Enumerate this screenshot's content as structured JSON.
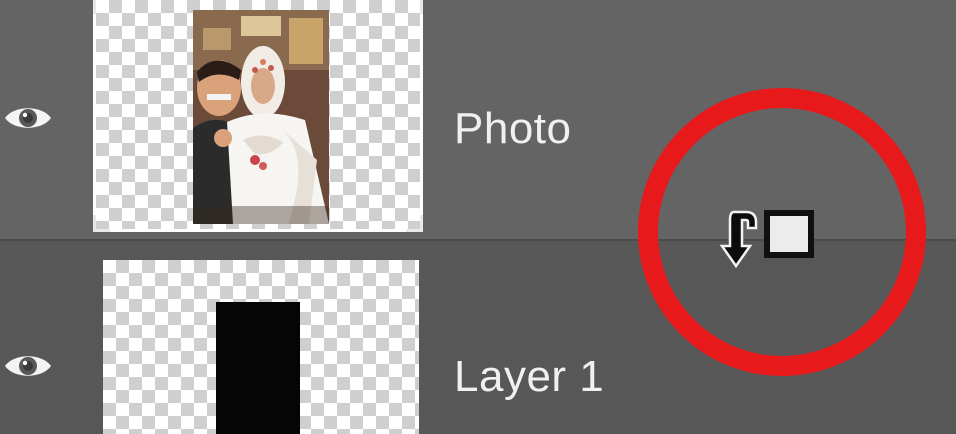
{
  "layers_panel": {
    "layers": [
      {
        "name": "Photo",
        "visible": true,
        "icon": "eye-icon",
        "thumbnail": "photo-thumbnail"
      },
      {
        "name": "Layer 1",
        "visible": true,
        "icon": "eye-icon",
        "thumbnail": "black-rectangle-mask"
      }
    ]
  },
  "annotation": {
    "type": "highlight-circle",
    "color": "#e8191b"
  },
  "cursor": {
    "icon": "clipping-mask-cursor-icon"
  },
  "colors": {
    "panel_top": "#646464",
    "panel_bottom": "#575757",
    "text": "#f0f0f0"
  }
}
